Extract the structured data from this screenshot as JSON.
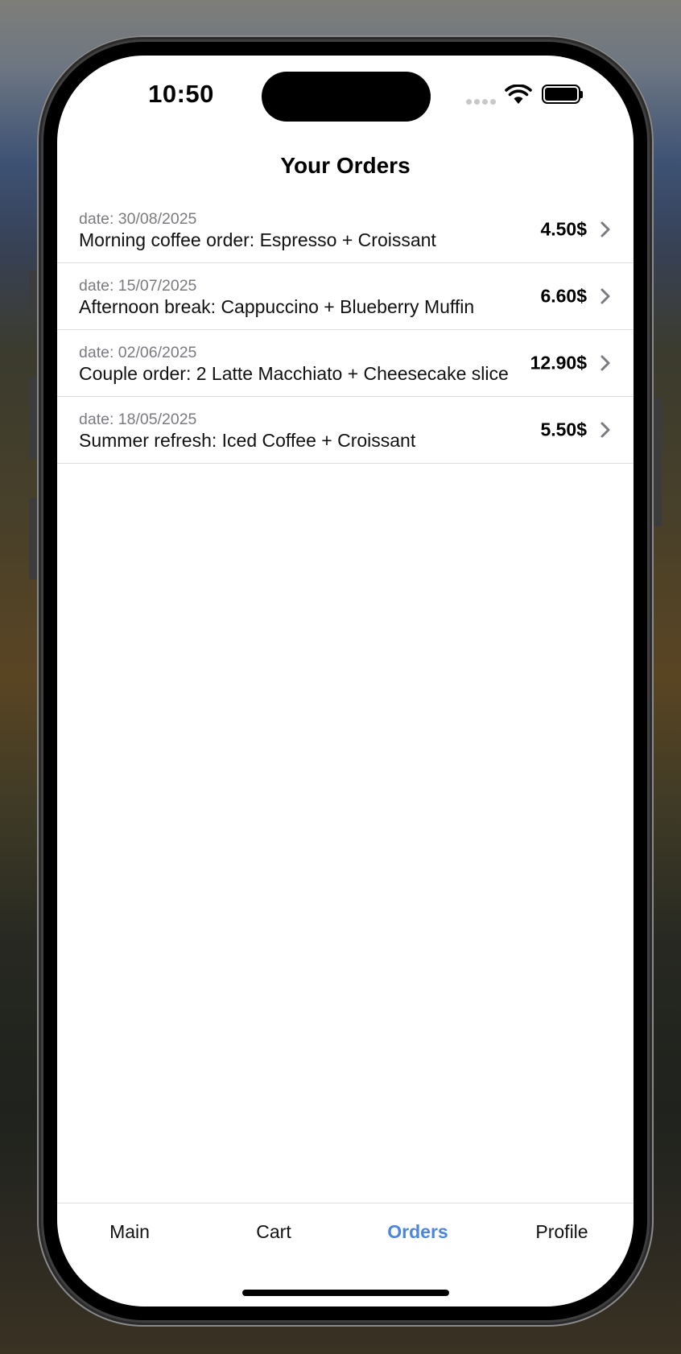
{
  "status_bar": {
    "time": "10:50",
    "wifi_icon": "wifi-icon",
    "battery_icon": "battery-full-icon"
  },
  "header": {
    "title": "Your Orders"
  },
  "orders": [
    {
      "date": "date: 30/08/2025",
      "description": "Morning coffee order: Espresso + Croissant",
      "price": "4.50$"
    },
    {
      "date": "date: 15/07/2025",
      "description": "Afternoon break: Cappuccino + Blueberry Muffin",
      "price": "6.60$"
    },
    {
      "date": "date: 02/06/2025",
      "description": "Couple order: 2 Latte Macchiato + Cheesecake slice",
      "price": "12.90$"
    },
    {
      "date": "date: 18/05/2025",
      "description": "Summer refresh: Iced Coffee + Croissant",
      "price": "5.50$"
    }
  ],
  "tab_bar": {
    "tabs": [
      {
        "label": "Main",
        "active": false
      },
      {
        "label": "Cart",
        "active": false
      },
      {
        "label": "Orders",
        "active": true
      },
      {
        "label": "Profile",
        "active": false
      }
    ]
  },
  "colors": {
    "accent": "#4a86dc",
    "secondary_text": "#7a7a82",
    "separator": "#dcdce0"
  }
}
